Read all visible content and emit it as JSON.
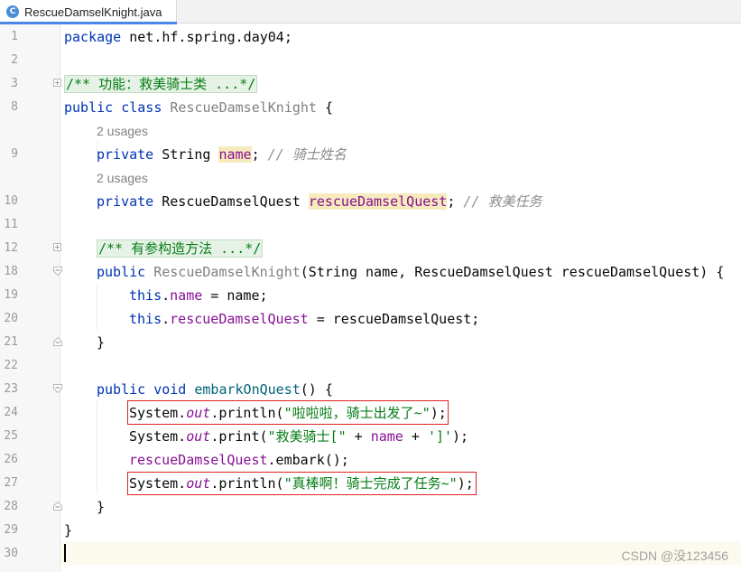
{
  "tab": {
    "icon_letter": "C",
    "label": "RescueDamselKnight.java"
  },
  "line_numbers": [
    "1",
    "2",
    "3",
    "8",
    "",
    "9",
    "",
    "10",
    "11",
    "12",
    "18",
    "19",
    "20",
    "21",
    "22",
    "23",
    "24",
    "25",
    "26",
    "27",
    "28",
    "29",
    "30"
  ],
  "code": {
    "l1": {
      "kw": "package",
      "rest": " net.hf.spring.day04;"
    },
    "l3": {
      "folded": "/** 功能：救美骑士类 ...*/"
    },
    "l8": {
      "kw1": "public",
      "kw2": "class",
      "cls": "RescueDamselKnight",
      "rest": " {"
    },
    "hint1": "2 usages",
    "l9": {
      "kw": "private",
      "type": " String ",
      "fld": "name",
      "semi": ";",
      "cmt": "// 骑士姓名"
    },
    "hint2": "2 usages",
    "l10": {
      "kw": "private",
      "type": " RescueDamselQuest ",
      "fld": "rescueDamselQuest",
      "semi": ";",
      "cmt": "// 救美任务"
    },
    "l12": {
      "folded": "/** 有参构造方法 ...*/"
    },
    "l18": {
      "kw": "public",
      "ctor": "RescueDamselKnight",
      "rest": "(String name, RescueDamselQuest rescueDamselQuest) {"
    },
    "l19": {
      "kw": "this",
      "dot": ".",
      "fld": "name",
      "rest": " = name;"
    },
    "l20": {
      "kw": "this",
      "dot": ".",
      "fld": "rescueDamselQuest",
      "rest": " = rescueDamselQuest;"
    },
    "l21": {
      "text": "}"
    },
    "l23": {
      "kw1": "public",
      "kw2": "void",
      "meth": "embarkOnQuest",
      "rest": "() {"
    },
    "l24": {
      "a": "System.",
      "out": "out",
      "b": ".println(",
      "str": "\"啦啦啦，骑士出发了~\"",
      "c": ");"
    },
    "l25": {
      "a": "System.",
      "out": "out",
      "b": ".print(",
      "str1": "\"救美骑士[\"",
      "plus1": " + ",
      "fld": "name",
      "plus2": " + ",
      "str2": "']'",
      "c": ");"
    },
    "l26": {
      "fld": "rescueDamselQuest",
      "rest": ".embark();"
    },
    "l27": {
      "a": "System.",
      "out": "out",
      "b": ".println(",
      "str": "\"真棒啊！骑士完成了任务~\"",
      "c": ");"
    },
    "l28": {
      "text": "}"
    },
    "l29": {
      "text": "}"
    }
  },
  "watermark": "CSDN @没123456"
}
